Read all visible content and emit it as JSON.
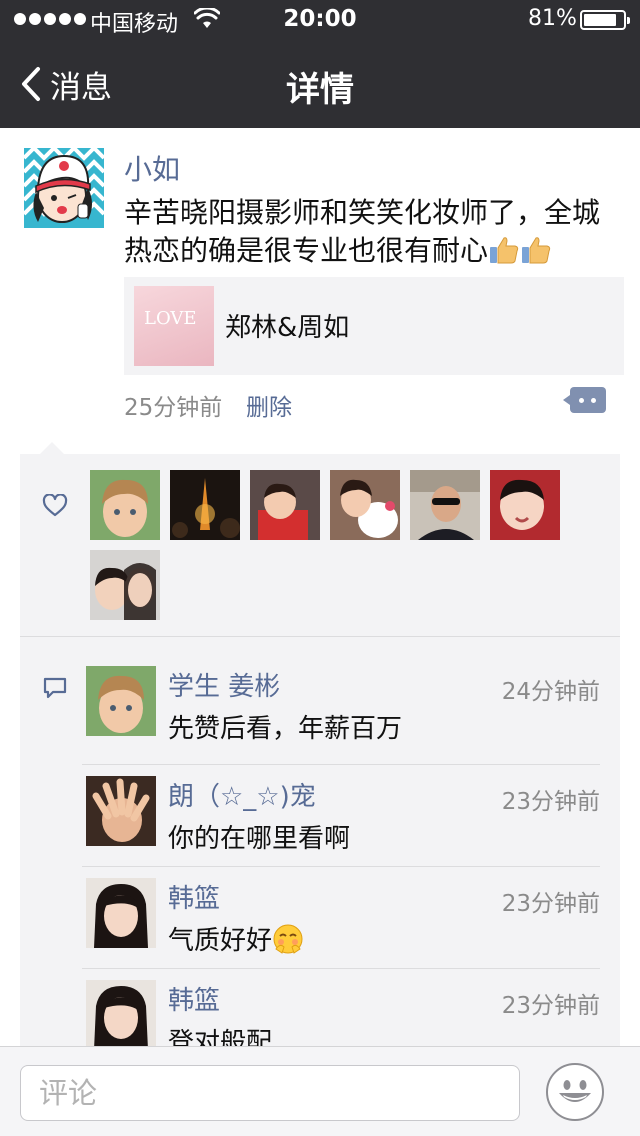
{
  "status_bar": {
    "carrier": "中国移动",
    "time": "20:00",
    "battery": "81%",
    "battery_level": 0.81
  },
  "nav": {
    "back_label": "消息",
    "title": "详情"
  },
  "post": {
    "author": "小如",
    "text": "辛苦晓阳摄影师和笑笑化妆师了，全城热恋的确是很专业也很有耐心",
    "emoji": [
      "thumbs-up",
      "thumbs-up"
    ],
    "share": {
      "title": "郑林&周如",
      "image_text": "LOVE"
    },
    "time": "25分钟前",
    "delete_label": "删除"
  },
  "likes": {
    "icon": "heart-icon",
    "count": 7
  },
  "comments": [
    {
      "name": "学生 姜彬",
      "time": "24分钟前",
      "text": "先赞后看，年薪百万"
    },
    {
      "name": "朗（☆_☆)宠",
      "time": "23分钟前",
      "text": "你的在哪里看啊"
    },
    {
      "name": "韩篮",
      "time": "23分钟前",
      "text": "气质好好",
      "emoji": "blushing-face"
    },
    {
      "name": "韩篮",
      "time": "23分钟前",
      "text": "登对般配"
    }
  ],
  "input": {
    "placeholder": "评论"
  },
  "colors": {
    "nav_bg": "#2f2f33",
    "link": "#576b95",
    "panel": "#f3f3f5"
  }
}
